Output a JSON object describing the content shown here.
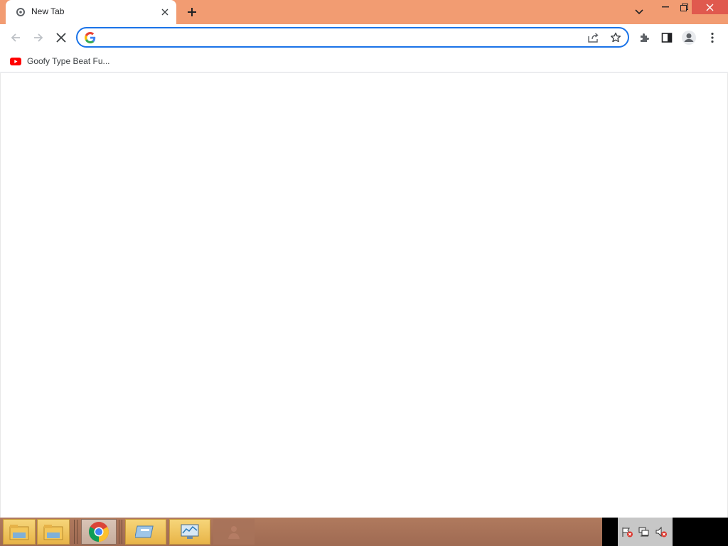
{
  "browser": {
    "tab": {
      "title": "New Tab"
    },
    "omnibox": {
      "value": "",
      "placeholder": ""
    },
    "bookmarks": [
      {
        "label": "Goofy Type Beat Fu...",
        "icon": "youtube-icon"
      }
    ]
  },
  "colors": {
    "titlebar": "#f29c72",
    "close_button": "#e0594e",
    "omnibox_focus": "#1a73e8",
    "taskbar": "#a9735a"
  },
  "taskbar": {
    "items": [
      {
        "name": "file-explorer-icon"
      },
      {
        "name": "file-explorer-icon"
      },
      {
        "name": "chrome-icon"
      },
      {
        "name": "control-panel-icon"
      },
      {
        "name": "performance-monitor-icon"
      },
      {
        "name": "user-icon"
      }
    ],
    "tray": [
      {
        "name": "action-center-flag-icon"
      },
      {
        "name": "network-icon"
      },
      {
        "name": "volume-muted-icon"
      }
    ]
  }
}
